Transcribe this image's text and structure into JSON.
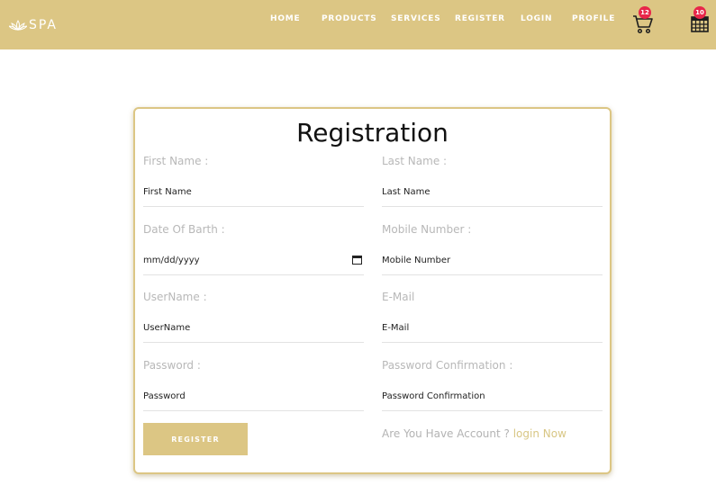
{
  "brand": {
    "name": "SPA",
    "logo_icon": "lotus-icon"
  },
  "nav": {
    "items": [
      {
        "label": "HOME"
      },
      {
        "label": "PRODUCTS"
      },
      {
        "label": "SERVICES"
      },
      {
        "label": "REGISTER"
      },
      {
        "label": "LOGIN"
      },
      {
        "label": "PROFILE"
      }
    ],
    "cart": {
      "icon": "cart-icon",
      "badge": "12"
    },
    "calendar": {
      "icon": "calendar-icon",
      "badge": "10"
    }
  },
  "form": {
    "title": "Registration",
    "fields": {
      "first_name": {
        "label": "First Name :",
        "placeholder": "First Name"
      },
      "last_name": {
        "label": "Last Name :",
        "placeholder": "Last Name"
      },
      "dob": {
        "label": "Date Of Barth :",
        "value": "mm/dd/yyyy"
      },
      "mobile": {
        "label": "Mobile Number :",
        "placeholder": "Mobile Number"
      },
      "username": {
        "label": "UserName :",
        "placeholder": "UserName"
      },
      "email": {
        "label": "E-Mail",
        "placeholder": "E-Mail"
      },
      "password": {
        "label": "Password :",
        "placeholder": "Password"
      },
      "password_confirmation": {
        "label": "Password Confirmation :",
        "placeholder": "Password Confirmation"
      }
    },
    "register_button": "REGISTER",
    "have_account_text": "Are You Have Account ?",
    "login_link": "login Now"
  },
  "colors": {
    "brand": "#dcc684",
    "badge": "#e8264a",
    "label": "#b8b8b8"
  }
}
